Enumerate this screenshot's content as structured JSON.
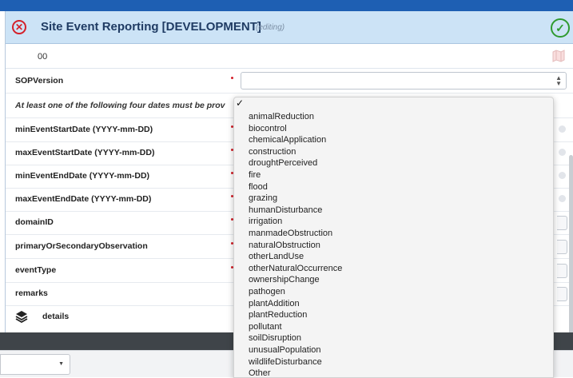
{
  "modal": {
    "title": "Site Event Reporting [DEVELOPMENT]",
    "status": "(editing)",
    "record_id": "00"
  },
  "form": {
    "sop_version_label": "SOPVersion",
    "dates_note": "At least one of the following four dates must be prov",
    "min_event_start_label": "minEventStartDate (YYYY-mm-DD)",
    "max_event_start_label": "maxEventStartDate (YYYY-mm-DD)",
    "min_event_end_label": "minEventEndDate (YYYY-mm-DD)",
    "max_event_end_label": "maxEventEndDate (YYYY-mm-DD)",
    "domain_id_label": "domainID",
    "observation_label": "primaryOrSecondaryObservation",
    "event_type_label": "eventType",
    "remarks_label": "remarks",
    "details_label": "details"
  },
  "dropdown": {
    "selected_mark": "✓",
    "options": [
      "animalReduction",
      "biocontrol",
      "chemicalApplication",
      "construction",
      "droughtPerceived",
      "fire",
      "flood",
      "grazing",
      "humanDisturbance",
      "irrigation",
      "manmadeObstruction",
      "naturalObstruction",
      "otherLandUse",
      "otherNaturalOccurrence",
      "ownershipChange",
      "pathogen",
      "plantAddition",
      "plantReduction",
      "pollutant",
      "soilDisruption",
      "unusualPopulation",
      "wildlifeDisturbance",
      "Other"
    ]
  },
  "icons": {
    "close": "close-icon",
    "confirm": "checkmark-icon",
    "map": "map-icon",
    "details": "layers-icon"
  },
  "colors": {
    "header_bg": "#cce3f6",
    "title": "#1f3b63",
    "close": "#d4202a",
    "confirm": "#2f9a2f",
    "required": "#d4202a"
  }
}
